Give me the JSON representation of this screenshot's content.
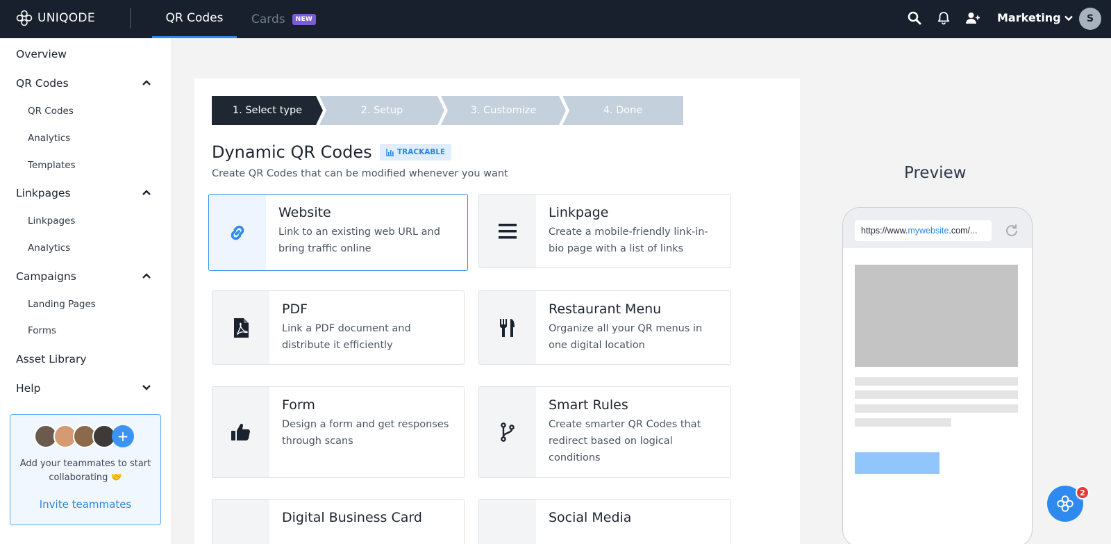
{
  "brand": {
    "name": "UNIQODE"
  },
  "topnav": {
    "tabs": [
      {
        "label": "QR Codes"
      },
      {
        "label": "Cards",
        "badge": "NEW"
      }
    ],
    "team_label": "Marketing",
    "avatar_initial": "S",
    "icons": [
      "search-icon",
      "bell-icon",
      "add-user-icon",
      "chevron-down-icon"
    ]
  },
  "sidebar": {
    "overview": "Overview",
    "qr_codes": {
      "label": "QR Codes",
      "items": [
        "QR Codes",
        "Analytics",
        "Templates"
      ]
    },
    "linkpages": {
      "label": "Linkpages",
      "items": [
        "Linkpages",
        "Analytics"
      ]
    },
    "campaigns": {
      "label": "Campaigns",
      "items": [
        "Landing Pages",
        "Forms"
      ]
    },
    "asset_library": "Asset Library",
    "help": "Help",
    "invite": {
      "text": "Add your teammates to start collaborating 🤝",
      "link": "Invite teammates"
    }
  },
  "steps": [
    "1. Select type",
    "2. Setup",
    "3. Customize",
    "4. Done"
  ],
  "main": {
    "title": "Dynamic QR Codes",
    "badge": "TRACKABLE",
    "subtitle": "Create QR Codes that can be modified whenever you want",
    "options": [
      {
        "title": "Website",
        "desc": "Link to an existing web URL and bring traffic online",
        "icon": "link-icon",
        "selected": true
      },
      {
        "title": "Linkpage",
        "desc": "Create a mobile-friendly link-in-bio page with a list of links",
        "icon": "menu-lines-icon"
      },
      {
        "title": "PDF",
        "desc": "Link a PDF document and distribute it efficiently",
        "icon": "pdf-file-icon"
      },
      {
        "title": "Restaurant Menu",
        "desc": "Organize all your QR menus in one digital location",
        "icon": "fork-knife-icon"
      },
      {
        "title": "Form",
        "desc": "Design a form and get responses through scans",
        "icon": "thumbs-up-icon"
      },
      {
        "title": "Smart Rules",
        "desc": "Create smarter QR Codes that redirect based on logical conditions",
        "icon": "branch-icon"
      },
      {
        "title": "Digital Business Card",
        "desc": "",
        "icon": "id-card-icon"
      },
      {
        "title": "Social Media",
        "desc": "",
        "icon": "share-icon"
      }
    ]
  },
  "preview": {
    "title": "Preview",
    "url_prefix": "https://www.",
    "url_highlight": "mywebsite",
    "url_suffix": ".com/..."
  },
  "chat": {
    "badge": "2"
  },
  "colors": {
    "accent": "#2f8af0",
    "topbar": "#17202c",
    "new_badge": "#7a5cd7",
    "step_active": "#1f2733",
    "step_inactive": "#c4d0dc"
  }
}
